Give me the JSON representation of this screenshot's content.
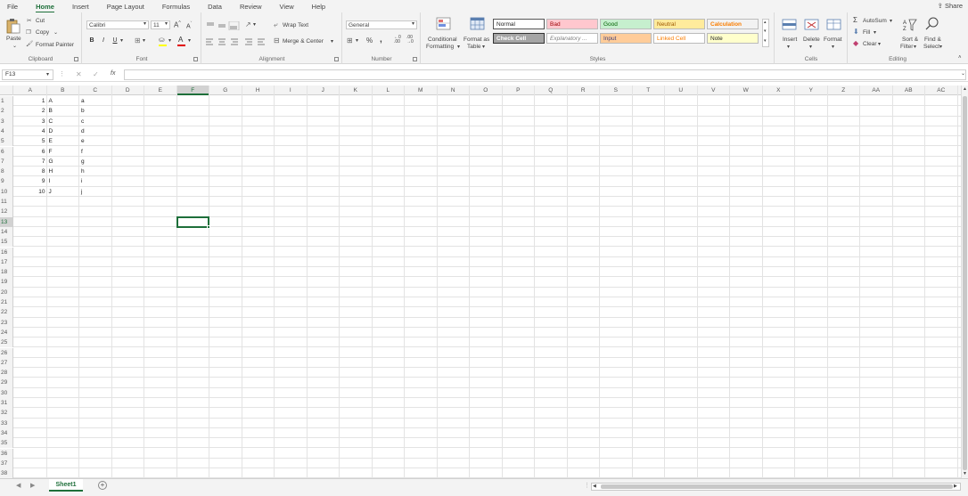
{
  "menu": {
    "tabs": [
      "File",
      "Home",
      "Insert",
      "Page Layout",
      "Formulas",
      "Data",
      "Review",
      "View",
      "Help"
    ],
    "active": "Home",
    "share_label": "Share"
  },
  "ribbon": {
    "clipboard": {
      "paste": "Paste",
      "cut": "Cut",
      "copy": "Copy",
      "format_painter": "Format Painter",
      "label": "Clipboard"
    },
    "font": {
      "name": "Calibri",
      "size": "11",
      "bold": "B",
      "italic": "I",
      "underline": "U",
      "label": "Font"
    },
    "alignment": {
      "wrap": "Wrap Text",
      "merge": "Merge & Center",
      "label": "Alignment"
    },
    "number": {
      "format": "General",
      "percent": "%",
      "comma": ",",
      "label": "Number"
    },
    "styles": {
      "conditional": "Conditional Formatting",
      "conditional_1": "Conditional",
      "conditional_2": "Formatting",
      "format_table_1": "Format as",
      "format_table_2": "Table",
      "items": [
        {
          "name": "Normal",
          "bg": "#ffffff",
          "fg": "#222222"
        },
        {
          "name": "Bad",
          "bg": "#ffc7ce",
          "fg": "#9c0006"
        },
        {
          "name": "Good",
          "bg": "#c6efce",
          "fg": "#006100"
        },
        {
          "name": "Neutral",
          "bg": "#ffeb9c",
          "fg": "#9c5700"
        },
        {
          "name": "Calculation",
          "bg": "#f2f2f2",
          "fg": "#fa7d00"
        },
        {
          "name": "Check Cell",
          "bg": "#a5a5a5",
          "fg": "#ffffff"
        },
        {
          "name": "Explanatory ...",
          "bg": "#ffffff",
          "fg": "#7f7f7f"
        },
        {
          "name": "Input",
          "bg": "#ffcc99",
          "fg": "#3f3f76"
        },
        {
          "name": "Linked Cell",
          "bg": "#ffffff",
          "fg": "#fa7d00"
        },
        {
          "name": "Note",
          "bg": "#ffffcc",
          "fg": "#222222"
        }
      ],
      "label": "Styles"
    },
    "cells": {
      "insert": "Insert",
      "delete": "Delete",
      "format": "Format",
      "label": "Cells"
    },
    "editing": {
      "autosum": "AutoSum",
      "fill": "Fill",
      "clear": "Clear",
      "sort_1": "Sort &",
      "sort_2": "Filter",
      "find_1": "Find &",
      "find_2": "Select",
      "label": "Editing"
    }
  },
  "formula_bar": {
    "name_box": "F13",
    "fx": "fx",
    "content": ""
  },
  "grid": {
    "columns": [
      "A",
      "B",
      "C",
      "D",
      "E",
      "F",
      "G",
      "H",
      "I",
      "J",
      "K",
      "L",
      "M",
      "N",
      "O",
      "P",
      "Q",
      "R",
      "S",
      "T",
      "U",
      "V",
      "W",
      "X",
      "Y",
      "Z",
      "AA",
      "AB",
      "AC"
    ],
    "selected_column": "F",
    "selected_row": 13,
    "row_count": 38,
    "data": [
      {
        "a": "1",
        "b": "A",
        "c": "a"
      },
      {
        "a": "2",
        "b": "B",
        "c": "b"
      },
      {
        "a": "3",
        "b": "C",
        "c": "c"
      },
      {
        "a": "4",
        "b": "D",
        "c": "d"
      },
      {
        "a": "5",
        "b": "E",
        "c": "e"
      },
      {
        "a": "6",
        "b": "F",
        "c": "f"
      },
      {
        "a": "7",
        "b": "G",
        "c": "g"
      },
      {
        "a": "8",
        "b": "H",
        "c": "h"
      },
      {
        "a": "9",
        "b": "I",
        "c": "i"
      },
      {
        "a": "10",
        "b": "J",
        "c": "j"
      }
    ]
  },
  "sheets": {
    "active": "Sheet1"
  }
}
